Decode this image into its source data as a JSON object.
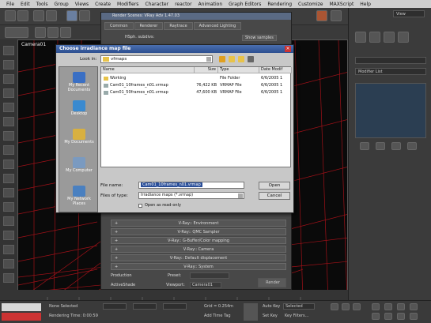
{
  "menu": [
    "File",
    "Edit",
    "Tools",
    "Group",
    "Views",
    "Create",
    "Modifiers",
    "Character",
    "reactor",
    "Animation",
    "Graph Editors",
    "Rendering",
    "Customize",
    "MAXScript",
    "Help"
  ],
  "viewport": {
    "label": "Camera01"
  },
  "command_panel": {
    "view_dropdown": "View",
    "modifier_list": "Modifier List"
  },
  "render_dialog": {
    "title": "Render Scenes: VRay Adv 1.47.03",
    "tabs": [
      "Common",
      "Renderer",
      "Raytrace",
      "Advanced Lighting"
    ],
    "hsph_label": "HSph. subdivs:",
    "show_samples": "Show samples",
    "rollouts": [
      "V-Ray:: Environment",
      "V-Ray:: QMC Sampler",
      "V-Ray:: G-Buffer/Color mapping",
      "V-Ray:: Camera",
      "V-Ray:: Default displacement",
      "V-Ray:: System"
    ],
    "production_label": "Production",
    "preset_label": "Preset:",
    "activeshade_label": "ActiveShade",
    "viewport_label": "Viewport:",
    "viewport_value": "Camera01",
    "render_button": "Render"
  },
  "file_dialog": {
    "title": "Choose irradiance map file",
    "look_in_label": "Look in:",
    "look_in_value": "vfmaps",
    "places": [
      "My Recent Documents",
      "Desktop",
      "My Documents",
      "My Computer",
      "My Network Places"
    ],
    "columns": [
      "Name",
      "Size",
      "Type",
      "Date Modif"
    ],
    "files": [
      {
        "name": "Working",
        "size": "",
        "type": "File Folder",
        "date": "6/6/2005 1"
      },
      {
        "name": "Cam01_10frames_n01.vrmap",
        "size": "76,422 KB",
        "type": "VRMAP File",
        "date": "6/6/2005 1"
      },
      {
        "name": "Cam01_50frames_n01.vrmap",
        "size": "47,600 KB",
        "type": "VRMAP File",
        "date": "6/6/2005 1"
      }
    ],
    "file_name_label": "File name:",
    "file_name_value": "Cam01_10frames_n01.vrmap",
    "file_type_label": "Files of type:",
    "file_type_value": "Irradiance maps (*.vrmap)",
    "open_readonly": "Open as read-only",
    "open_button": "Open",
    "cancel_button": "Cancel"
  },
  "status": {
    "none_selected": "None Selected",
    "rendering_time": "Rendering Time: 0:00:59",
    "grid": "Grid = 0.254m",
    "add_time_tag": "Add Time Tag",
    "auto_key": "Auto Key",
    "selected": "Selected",
    "set_key": "Set Key",
    "key_filters": "Key Filters..."
  }
}
